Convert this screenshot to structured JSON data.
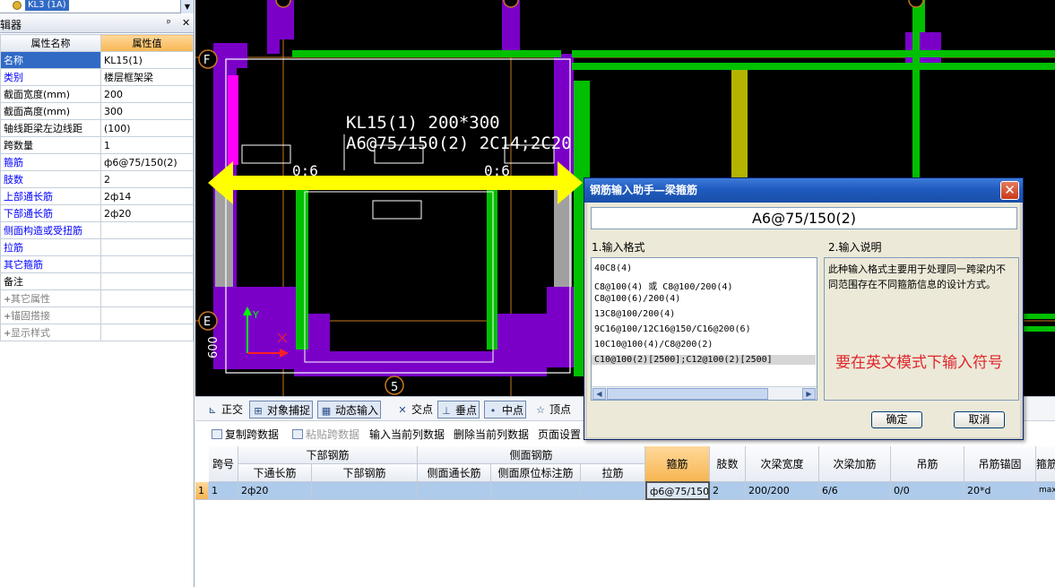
{
  "left_panel": {
    "combo_text": "KL3 (1A)",
    "title": "辑器",
    "pin": "ᵖ",
    "close": "✕",
    "header_name": "属性名称",
    "header_value": "属性值",
    "rows": [
      {
        "name": "名称",
        "value": "KL15(1)",
        "style": "blue"
      },
      {
        "name": "类别",
        "value": "楼层框架梁",
        "style": "blue"
      },
      {
        "name": "截面宽度(mm)",
        "value": "200",
        "style": "black"
      },
      {
        "name": "截面高度(mm)",
        "value": "300",
        "style": "black"
      },
      {
        "name": "轴线距梁左边线距",
        "value": "(100)",
        "style": "black"
      },
      {
        "name": "跨数量",
        "value": "1",
        "style": "black"
      },
      {
        "name": "箍筋",
        "value": "ф6@75/150(2)",
        "style": "blue"
      },
      {
        "name": "肢数",
        "value": "2",
        "style": "blue"
      },
      {
        "name": "上部通长筋",
        "value": "2ф14",
        "style": "blue"
      },
      {
        "name": "下部通长筋",
        "value": "2ф20",
        "style": "blue"
      },
      {
        "name": "侧面构造或受扭筋",
        "value": "",
        "style": "blue"
      },
      {
        "name": "拉筋",
        "value": "",
        "style": "blue"
      },
      {
        "name": "其它箍筋",
        "value": "",
        "style": "blue"
      },
      {
        "name": "备注",
        "value": "",
        "style": "black"
      },
      {
        "name": "其它属性",
        "value": "",
        "style": "grey"
      },
      {
        "name": "锚固搭接",
        "value": "",
        "style": "grey"
      },
      {
        "name": "显示样式",
        "value": "",
        "style": "grey"
      }
    ]
  },
  "cad": {
    "beam_label_1": "KL15(1) 200*300",
    "beam_label_2": "A6@75/150(2) 2C14;2C20",
    "span_left": "0:6",
    "span_right": "0:6",
    "axis_f": "F",
    "axis_e": "E",
    "axis_5": "5",
    "dim_600": "600",
    "axis_y": "Y",
    "colors": {
      "wall": "#7a00c8",
      "beam": "#00c000",
      "magenta": "#ff00ff",
      "yellow": "#ffff00",
      "olive": "#b4b400",
      "grey": "#a0a0a0",
      "axis_line": "#c87820"
    }
  },
  "snap_toolbar": {
    "ortho": "正交",
    "object_snap": "对象捕捉",
    "dynamic_input": "动态输入",
    "intersection": "交点",
    "perpendicular": "垂点",
    "midpoint": "中点",
    "vertex": "顶点"
  },
  "edit_toolbar": {
    "copy_span": "复制跨数据",
    "paste_span": "粘贴跨数据",
    "input_column": "输入当前列数据",
    "delete_column": "删除当前列数据",
    "page_setup": "页面设置"
  },
  "grid": {
    "h_span": "跨号",
    "h_bottom_group": "下部钢筋",
    "h_bottom_through": "下通长筋",
    "h_bottom_bar": "下部钢筋",
    "h_side_group": "侧面钢筋",
    "h_side_through": "侧面通长筋",
    "h_side_original": "侧面原位标注筋",
    "h_tie": "拉筋",
    "h_stirrup": "箍筋",
    "h_legs": "肢数",
    "h_sec_width": "次梁宽度",
    "h_sec_bar": "次梁加筋",
    "h_hanger": "吊筋",
    "h_hanger_anchor": "吊筋锚固",
    "h_cut": "箍筋",
    "row": {
      "index": "1",
      "span": "1",
      "bottom_through": "2ф20",
      "stirrup": "ф6@75/150",
      "legs": "2",
      "sec_width": "200/200",
      "sec_bar": "6/6",
      "hanger": "0/0",
      "hanger_anchor": "20*d",
      "cut": "max"
    }
  },
  "dialog": {
    "title": "钢筋输入助手—梁箍筋",
    "input_value": "A6@75/150(2)",
    "format_label": "1.输入格式",
    "desc_label": "2.输入说明",
    "formats": [
      "40C8(4)",
      "C8@100(4) 或 C8@100/200(4)",
      "C8@100(6)/200(4)",
      "13C8@100/200(4)",
      "9C16@100/12C16@150/C16@200(6)",
      "10C10@100(4)/C8@200(2)",
      "C10@100(2)[2500];C12@100(2)[2500]"
    ],
    "description": "此种输入格式主要用于处理同一跨梁内不同范围存在不同箍筋信息的设计方式。",
    "ok": "确定",
    "cancel": "取消",
    "annotation": "要在英文模式下输入符号"
  }
}
